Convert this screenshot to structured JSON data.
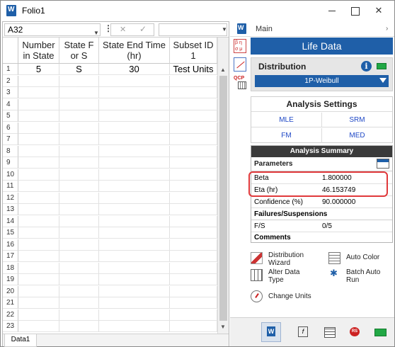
{
  "window": {
    "title": "Folio1"
  },
  "formula_bar": {
    "cell_ref": "A32"
  },
  "grid": {
    "columns": [
      {
        "label": "Number in State"
      },
      {
        "label": "State F or S"
      },
      {
        "label": "State End Time (hr)"
      },
      {
        "label": "Subset ID 1"
      }
    ],
    "rows": [
      {
        "num": "1",
        "cells": [
          "5",
          "S",
          "30",
          "Test Units"
        ]
      },
      {
        "num": "2",
        "cells": [
          "",
          "",
          "",
          ""
        ]
      },
      {
        "num": "3",
        "cells": [
          "",
          "",
          "",
          ""
        ]
      },
      {
        "num": "4",
        "cells": [
          "",
          "",
          "",
          ""
        ]
      },
      {
        "num": "5",
        "cells": [
          "",
          "",
          "",
          ""
        ]
      },
      {
        "num": "6",
        "cells": [
          "",
          "",
          "",
          ""
        ]
      },
      {
        "num": "7",
        "cells": [
          "",
          "",
          "",
          ""
        ]
      },
      {
        "num": "8",
        "cells": [
          "",
          "",
          "",
          ""
        ]
      },
      {
        "num": "9",
        "cells": [
          "",
          "",
          "",
          ""
        ]
      },
      {
        "num": "10",
        "cells": [
          "",
          "",
          "",
          ""
        ]
      },
      {
        "num": "11",
        "cells": [
          "",
          "",
          "",
          ""
        ]
      },
      {
        "num": "12",
        "cells": [
          "",
          "",
          "",
          ""
        ]
      },
      {
        "num": "13",
        "cells": [
          "",
          "",
          "",
          ""
        ]
      },
      {
        "num": "14",
        "cells": [
          "",
          "",
          "",
          ""
        ]
      },
      {
        "num": "15",
        "cells": [
          "",
          "",
          "",
          ""
        ]
      },
      {
        "num": "16",
        "cells": [
          "",
          "",
          "",
          ""
        ]
      },
      {
        "num": "17",
        "cells": [
          "",
          "",
          "",
          ""
        ]
      },
      {
        "num": "18",
        "cells": [
          "",
          "",
          "",
          ""
        ]
      },
      {
        "num": "19",
        "cells": [
          "",
          "",
          "",
          ""
        ]
      },
      {
        "num": "20",
        "cells": [
          "",
          "",
          "",
          ""
        ]
      },
      {
        "num": "21",
        "cells": [
          "",
          "",
          "",
          ""
        ]
      },
      {
        "num": "22",
        "cells": [
          "",
          "",
          "",
          ""
        ]
      },
      {
        "num": "23",
        "cells": [
          "",
          "",
          "",
          ""
        ]
      }
    ]
  },
  "sheet_tabs": [
    {
      "label": "Data1"
    }
  ],
  "panel": {
    "header": "Main",
    "title": "Life Data",
    "distribution": {
      "label": "Distribution",
      "info": "i",
      "selected": "1P-Weibull",
      "status_color": "#22a845"
    },
    "analysis_settings": {
      "title": "Analysis Settings",
      "mle": "MLE",
      "srm": "SRM",
      "fm": "FM",
      "med": "MED"
    },
    "analysis_summary": {
      "title": "Analysis Summary",
      "parameters_label": "Parameters",
      "beta_label": "Beta",
      "beta_value": "1.800000",
      "eta_label": "Eta (hr)",
      "eta_value": "46.153749",
      "confidence_label": "Confidence (%)",
      "confidence_value": "90.000000",
      "failures_label": "Failures/Suspensions",
      "fs_label": "F/S",
      "fs_value": "0/5",
      "comments_label": "Comments"
    },
    "actions": {
      "wizard": "Distribution Wizard",
      "auto_color": "Auto Color",
      "alter": "Alter Data Type",
      "batch": "Batch Auto Run",
      "units": "Change Units"
    }
  },
  "colors": {
    "accent": "#1f5fa8",
    "highlight": "#e0393b",
    "status_green": "#22a845"
  }
}
